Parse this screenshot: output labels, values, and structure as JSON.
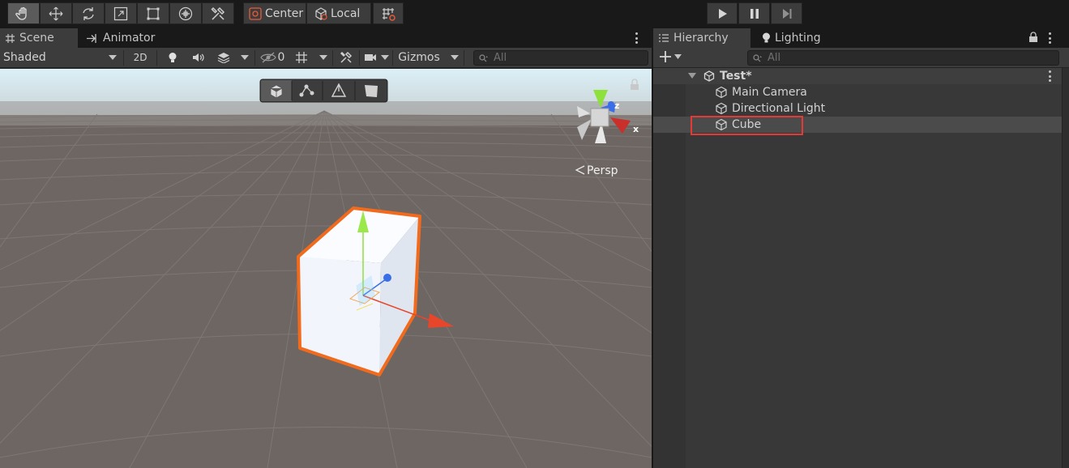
{
  "toolbar": {
    "pivot_mode": "Center",
    "pivot_rotation": "Local",
    "tool_icons": [
      "hand-icon",
      "move-icon",
      "rotate-icon",
      "scale-icon",
      "rect-icon",
      "transform-icon",
      "custom-tools-icon"
    ],
    "play_controls": [
      "play-icon",
      "pause-icon",
      "step-icon"
    ]
  },
  "scene_panel": {
    "tabs": [
      {
        "label": "Scene",
        "icon": "grid-icon"
      },
      {
        "label": "Animator",
        "icon": "animator-icon"
      }
    ],
    "draw_mode": "Shaded",
    "mode_2d": "2D",
    "hidden_count": "0",
    "gizmos_label": "Gizmos",
    "search_placeholder": "All",
    "projection_label": "Persp",
    "gizmo_axis_labels": {
      "x": "x",
      "z": "z"
    },
    "scene_view_modes": [
      "cube-icon",
      "nodes-icon",
      "pen-icon",
      "plane-icon"
    ]
  },
  "hierarchy_panel": {
    "tabs": [
      {
        "label": "Hierarchy",
        "icon": "list-icon"
      },
      {
        "label": "Lighting",
        "icon": "lightbulb-icon"
      }
    ],
    "search_placeholder": "All",
    "scene_name": "Test*",
    "items": [
      {
        "label": "Main Camera",
        "icon": "gameobject-icon"
      },
      {
        "label": "Directional Light",
        "icon": "gameobject-icon"
      },
      {
        "label": "Cube",
        "icon": "gameobject-icon",
        "selected": true
      }
    ]
  },
  "colors": {
    "selection_outline": "#f26b1d",
    "highlight_box": "#e53935",
    "axis_x": "#e8462a",
    "axis_y": "#8ee03a",
    "axis_z": "#3a6ee8"
  }
}
